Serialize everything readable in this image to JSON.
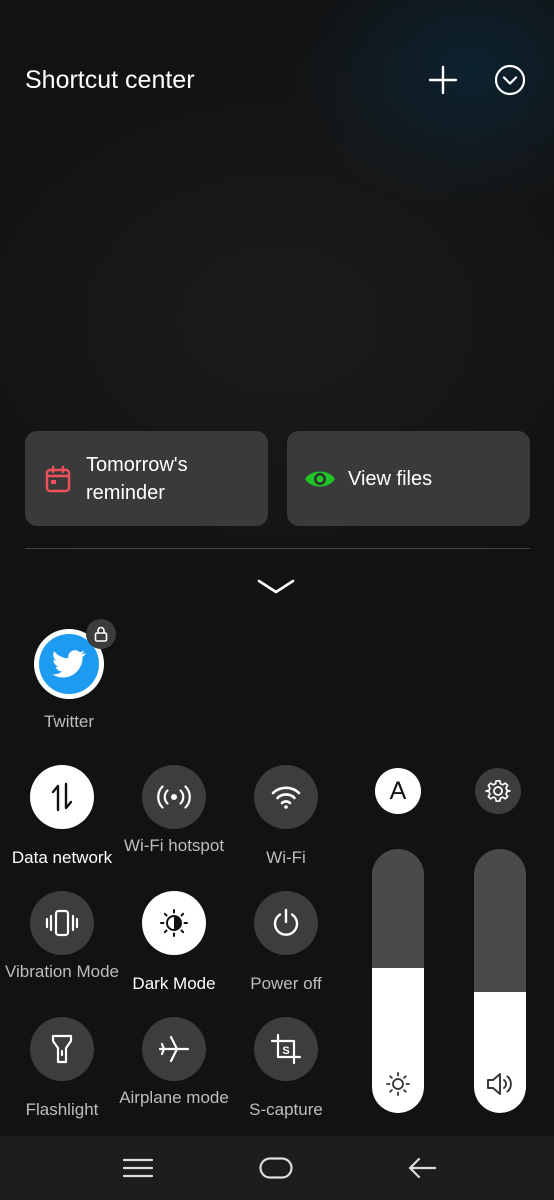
{
  "header": {
    "title": "Shortcut center",
    "add_icon": "plus-icon",
    "collapse_icon": "chevron-down-circle-icon"
  },
  "cards": [
    {
      "label": "Tomorrow's reminder",
      "icon": "calendar-icon",
      "icon_color": "#f0505a"
    },
    {
      "label": "View files",
      "icon": "eye-icon",
      "icon_color": "#22c22a"
    }
  ],
  "expand_icon": "chevron-down-icon",
  "apps": [
    {
      "label": "Twitter",
      "icon": "twitter-bird-icon",
      "badge": "lock-icon",
      "brand_color": "#1d9bf0"
    }
  ],
  "toggles": [
    {
      "label": "Data network",
      "icon": "data-arrows-icon",
      "on": true
    },
    {
      "label": "Wi-Fi hotspot",
      "icon": "hotspot-icon",
      "on": false
    },
    {
      "label": "Wi-Fi",
      "icon": "wifi-icon",
      "on": false
    },
    {
      "label": "Vibration Mode",
      "icon": "vibration-icon",
      "on": false
    },
    {
      "label": "Dark Mode",
      "icon": "dark-mode-icon",
      "on": true
    },
    {
      "label": "Power off",
      "icon": "power-icon",
      "on": false
    },
    {
      "label": "Flashlight",
      "icon": "flashlight-icon",
      "on": false
    },
    {
      "label": "Airplane mode",
      "icon": "airplane-icon",
      "on": false
    },
    {
      "label": "S-capture",
      "icon": "screenshot-crop-icon",
      "on": false
    }
  ],
  "controls": {
    "auto_brightness_label": "A",
    "settings_icon": "gear-icon",
    "brightness": {
      "icon": "sun-icon",
      "level": 0.55
    },
    "volume": {
      "icon": "speaker-icon",
      "level": 0.46
    }
  },
  "navbar": {
    "menu_icon": "menu-icon",
    "home_icon": "home-icon",
    "back_icon": "back-icon"
  }
}
